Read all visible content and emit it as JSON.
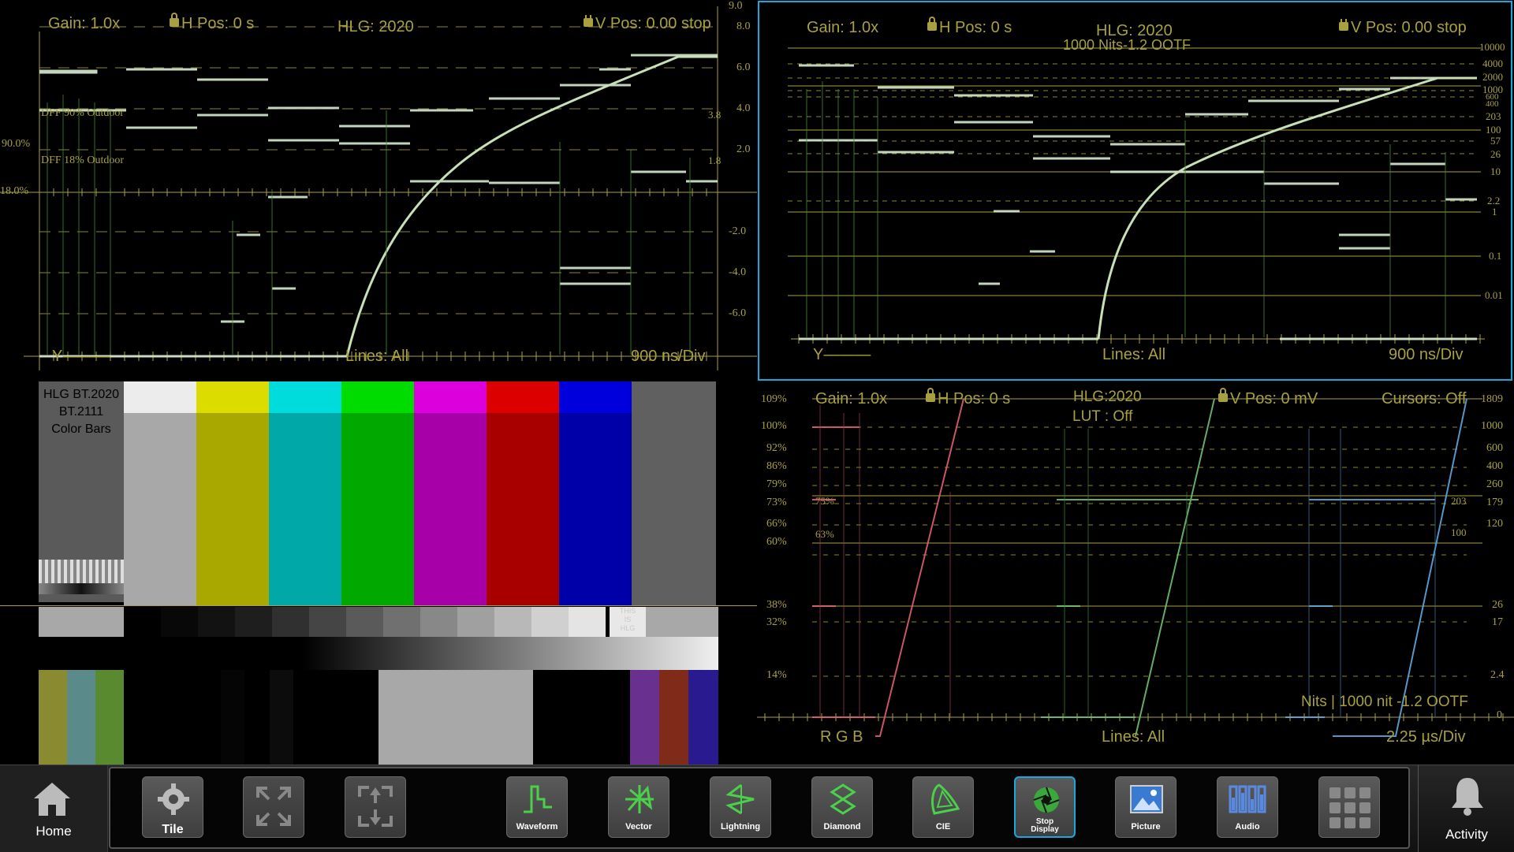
{
  "wf1": {
    "gain": "Gain: 1.0x",
    "hpos": "H Pos: 0 s",
    "title": "HLG: 2020",
    "vpos": "V Pos: 0.00 stop",
    "lines": "Lines: All",
    "channel": "Y———",
    "timebase": "900 ns/Div",
    "left_scale": [
      "90.0%",
      "18.0%"
    ],
    "right_scale": [
      "9.0",
      "8.0",
      "6.0",
      "4.0",
      "3.8",
      "2.0",
      "1.8",
      "-2.0",
      "-4.0",
      "-6.0"
    ],
    "dff1": "DFF 90% Outdoor",
    "dff2": "DFF 18% Outdoor"
  },
  "wf2": {
    "gain": "Gain: 1.0x",
    "hpos": "H Pos: 0 s",
    "title": "HLG: 2020",
    "subtitle": "1000 Nits-1.2 OOTF",
    "vpos": "V Pos: 0.00 stop",
    "lines": "Lines: All",
    "channel": "Y———",
    "timebase": "900 ns/Div",
    "right_scale": [
      "10000",
      "4000",
      "2000",
      "1000",
      "600",
      "400",
      "203",
      "100",
      "57",
      "26",
      "10",
      "2.2",
      "1",
      "0.1",
      "0.01"
    ]
  },
  "bars": {
    "title_lines": [
      "HLG BT.2020",
      "BT.2111",
      "Color Bars"
    ],
    "hlg_text": [
      "THIS",
      "IS",
      "HLG"
    ],
    "main_colors": [
      "#a8a8a8",
      "#a8a800",
      "#00a8a8",
      "#00a800",
      "#a800a8",
      "#a80000",
      "#0000a8",
      "#606060"
    ],
    "top_colors": [
      "#ececec",
      "#dcdc00",
      "#00dcdc",
      "#00dc00",
      "#dc00dc",
      "#dc0000",
      "#0000dc"
    ],
    "steps": [
      "#000000",
      "#080808",
      "#121212",
      "#1e1e1e",
      "#303030",
      "#454545",
      "#5a5a5a",
      "#707070",
      "#888888",
      "#a0a0a0",
      "#b8b8b8",
      "#d0d0d0",
      "#e4e4e4"
    ]
  },
  "rgb": {
    "gain": "Gain: 1.0x",
    "hpos": "H Pos: 0 s",
    "title": "HLG:2020",
    "lut": "LUT : Off",
    "vpos": "V Pos: 0 mV",
    "cursors": "Cursors: Off",
    "channel": "R G B",
    "lines": "Lines: All",
    "timebase": "2.25 µs/Div",
    "nits": "Nits | 1000 nit -1.2 OOTF",
    "left_scale": [
      "109%",
      "100%",
      "92%",
      "86%",
      "79%",
      "73%",
      "66%",
      "60%",
      "38%",
      "32%",
      "14%"
    ],
    "right_scale": [
      "1809",
      "1000",
      "600",
      "400",
      "260",
      "179",
      "120",
      "26",
      "17",
      "2.4",
      "0"
    ],
    "inner_labels": [
      "75%",
      "63%",
      "203",
      "100"
    ]
  },
  "toolbar": {
    "home": "Home",
    "tile": "Tile",
    "waveform": "Waveform",
    "vector": "Vector",
    "lightning": "Lightning",
    "diamond": "Diamond",
    "cie": "CIE",
    "stop_display": [
      "Stop",
      "Display"
    ],
    "picture": "Picture",
    "audio": "Audio",
    "activity": "Activity"
  },
  "colors": {
    "graticule": "#a8a040",
    "trace": "#d8ecd0",
    "accent": "#19a8dc"
  }
}
